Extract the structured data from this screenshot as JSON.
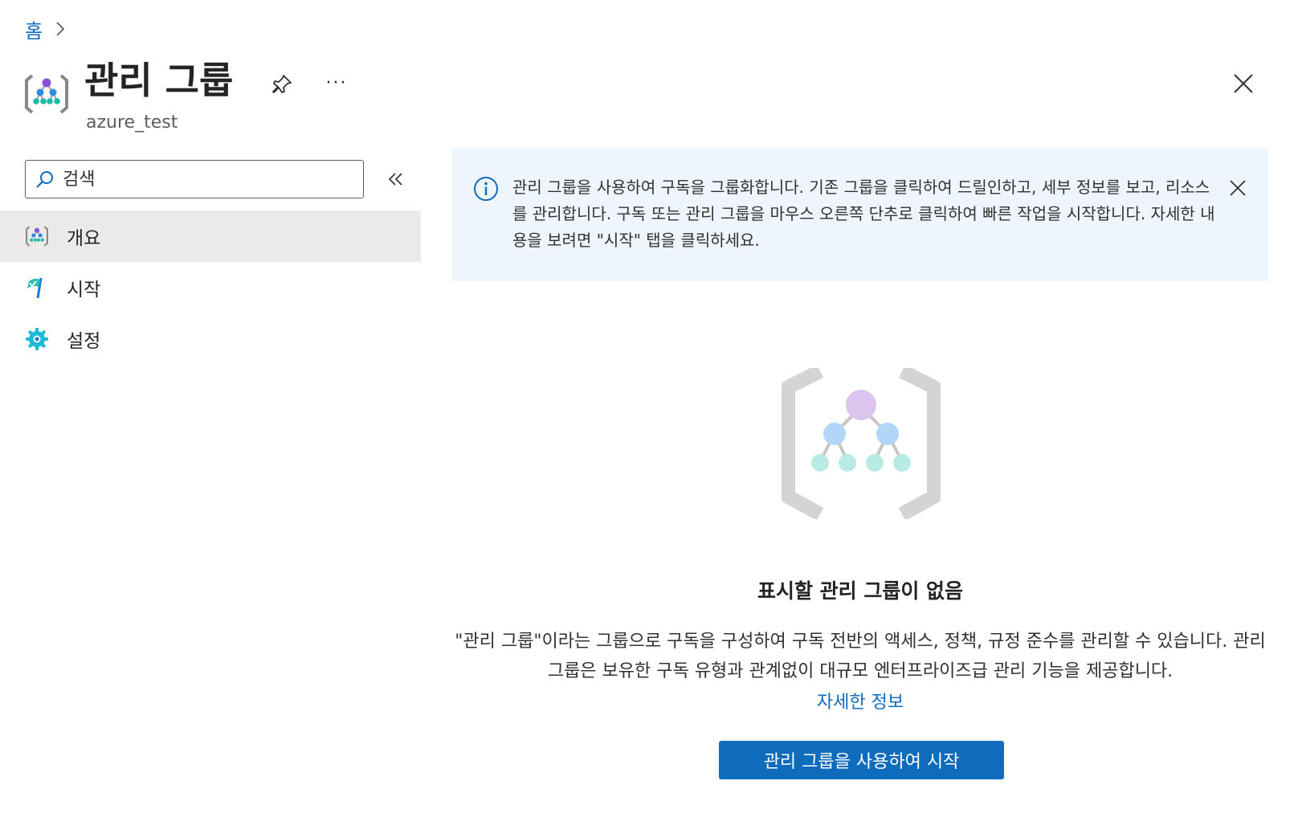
{
  "breadcrumb": {
    "home": "홈"
  },
  "header": {
    "title": "관리 그룹",
    "subtitle": "azure_test",
    "more_label": "···"
  },
  "search": {
    "placeholder": "검색"
  },
  "sidebar": {
    "items": [
      {
        "label": "개요",
        "icon": "management-group-icon",
        "active": true
      },
      {
        "label": "시작",
        "icon": "quickstart-flag-icon",
        "active": false
      },
      {
        "label": "설정",
        "icon": "settings-gear-icon",
        "active": false
      }
    ]
  },
  "banner": {
    "text": "관리 그룹을 사용하여 구독을 그룹화합니다. 기존 그룹을 클릭하여 드릴인하고, 세부 정보를 보고, 리소스를 관리합니다. 구독 또는 관리 그룹을 마우스 오른쪽 단추로 클릭하여 빠른 작업을 시작합니다. 자세한 내용을 보려면 \"시작\" 탭을 클릭하세요."
  },
  "empty_state": {
    "title": "표시할 관리 그룹이 없음",
    "description": "\"관리 그룹\"이라는 그룹으로 구독을 구성하여 구독 전반의 액세스, 정책, 규정 준수를 관리할 수 있습니다. 관리 그룹은 보유한 구독 유형과 관계없이 대규모 엔터프라이즈급 관리 기능을 제공합니다.",
    "learn_more": "자세한 정보",
    "cta": "관리 그룹을 사용하여 시작"
  },
  "colors": {
    "accent": "#0f6cbd",
    "banner_bg": "#eef5fd",
    "active_nav_bg": "#ebeae9",
    "icon_purple": "#b68ee0",
    "icon_blue": "#7ab8f0",
    "icon_teal": "#5ad1c6"
  }
}
